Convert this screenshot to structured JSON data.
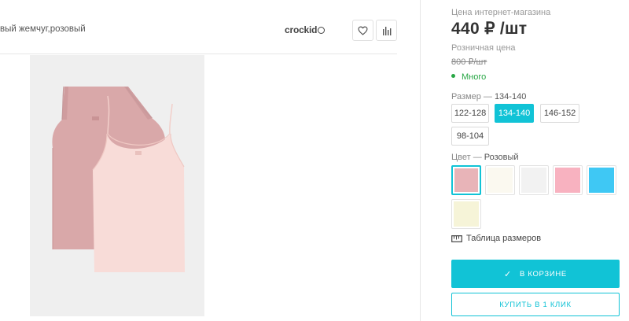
{
  "product": {
    "subtitle": "вый жемчуг,розовый",
    "brand": "crockid"
  },
  "actions": {
    "favorite_icon": "heart-icon",
    "compare_icon": "bar-chart-icon"
  },
  "pricing": {
    "online_label": "Цена интернет-магазина",
    "online_price": "440 ₽ /шт",
    "retail_label": "Розничная цена",
    "retail_price": "800 ₽/шт",
    "stock_status": "Много",
    "stock_color": "#28a745"
  },
  "size": {
    "label": "Размер",
    "dash": "—",
    "selected": "134-140",
    "options": [
      "122-128",
      "134-140",
      "146-152",
      "98-104"
    ]
  },
  "color": {
    "label": "Цвет",
    "dash": "—",
    "selected": "Розовый",
    "swatches": [
      "#e8b4b8",
      "#fbf9f0",
      "#f2f2f2",
      "#f8b2c0",
      "#3fc8f4",
      "#f6f4d8"
    ]
  },
  "links": {
    "size_table": "Таблица размеров"
  },
  "buttons": {
    "in_cart": "В КОРЗИНЕ",
    "one_click": "КУПИТЬ В 1 КЛИК"
  },
  "accent_color": "#11c3d6"
}
